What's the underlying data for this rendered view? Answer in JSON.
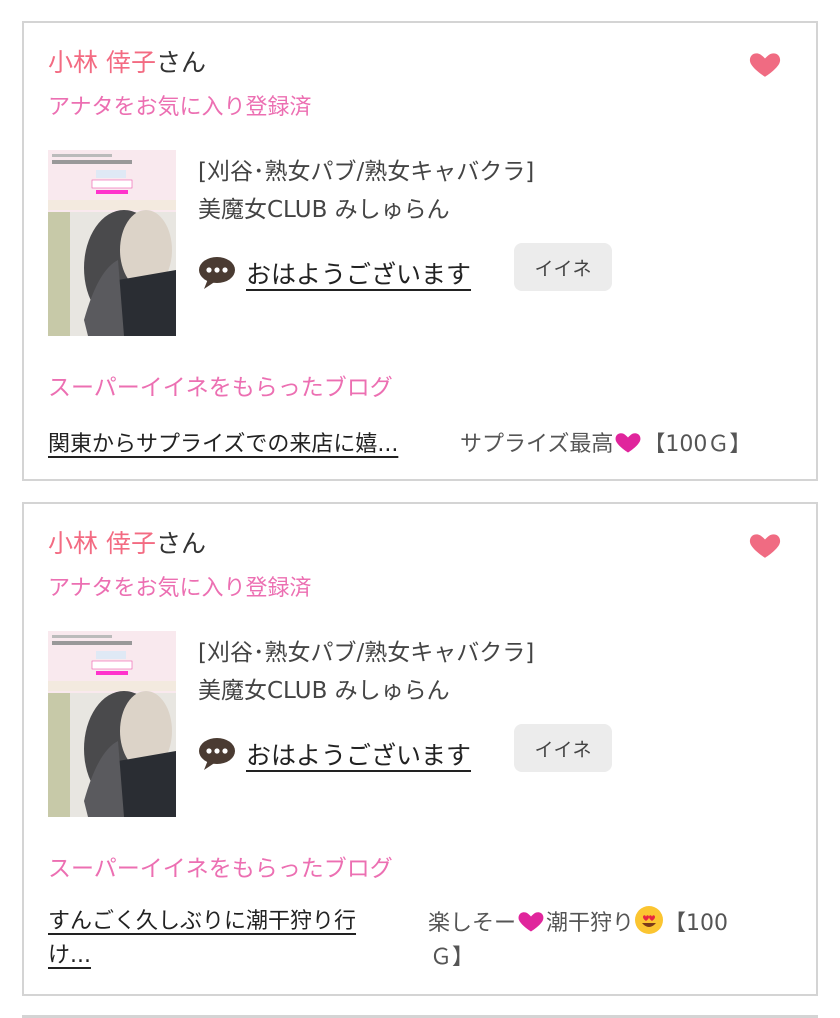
{
  "cards": [
    {
      "user_name": "小林 倖子",
      "user_suffix": "さん",
      "fav_status": "アナタをお気に入り登録済",
      "shop_category": "[刈谷･熟女パブ/熟女キャバクラ]",
      "shop_name": "美魔女CLUB みしゅらん",
      "message": "おはようございます",
      "like_label": "イイネ",
      "super_like_title": "スーパーイイネをもらったブログ",
      "blog_title": "関東からサプライズでの来店に嬉...",
      "comment_before": "サプライズ最高",
      "comment_middle": "",
      "comment_after": "【100Ｇ】"
    },
    {
      "user_name": "小林 倖子",
      "user_suffix": "さん",
      "fav_status": "アナタをお気に入り登録済",
      "shop_category": "[刈谷･熟女パブ/熟女キャバクラ]",
      "shop_name": "美魔女CLUB みしゅらん",
      "message": "おはようございます",
      "like_label": "イイネ",
      "super_like_title": "スーパーイイネをもらったブログ",
      "blog_title_line1": "すんごく久しぶりに潮干狩り行",
      "blog_title_line2": "け...",
      "comment_before": "楽しそー",
      "comment_middle": "潮干狩り",
      "comment_after_line1": "【100",
      "comment_after_line2": "Ｇ】"
    }
  ],
  "colors": {
    "name": "#f36b82",
    "accent": "#ec6fb2",
    "heart": "#f06b82",
    "border": "#d4d4d4"
  }
}
